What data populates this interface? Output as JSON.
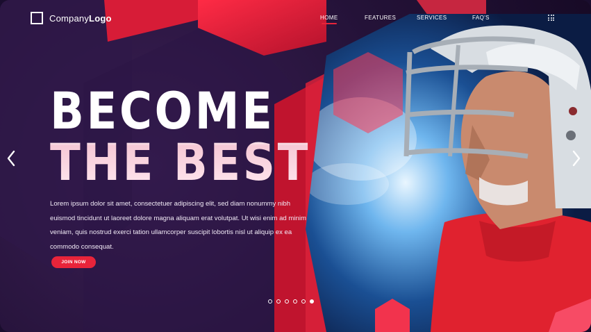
{
  "header": {
    "logo_regular": "Company",
    "logo_bold": "Logo",
    "nav": [
      "HOME",
      "FEATURES",
      "SERVICES",
      "FAQ'S"
    ],
    "active_nav": "HOME"
  },
  "hero": {
    "headline_line1": "BECOME",
    "headline_line2": "THE BEST",
    "body": "Lorem ipsum dolor sit amet, consectetuer adipiscing elit, sed diam nonummy nibh euismod tincidunt ut laoreet dolore magna aliquam erat volutpat. Ut wisi enim ad minim veniam, quis nostrud exerci tation ullamcorper suscipit lobortis nisl ut aliquip ex ea commodo consequat.",
    "cta_label": "JOIN NOW"
  },
  "slider": {
    "total": 6,
    "active_index": 5
  },
  "icons": [
    "logo-square-icon",
    "grid-menu-icon",
    "chevron-left-icon",
    "chevron-right-icon"
  ],
  "colors": {
    "accent": "#e8243a",
    "background": "#241238",
    "jersey": "#e0222f",
    "helmet": "#d8dde2"
  }
}
